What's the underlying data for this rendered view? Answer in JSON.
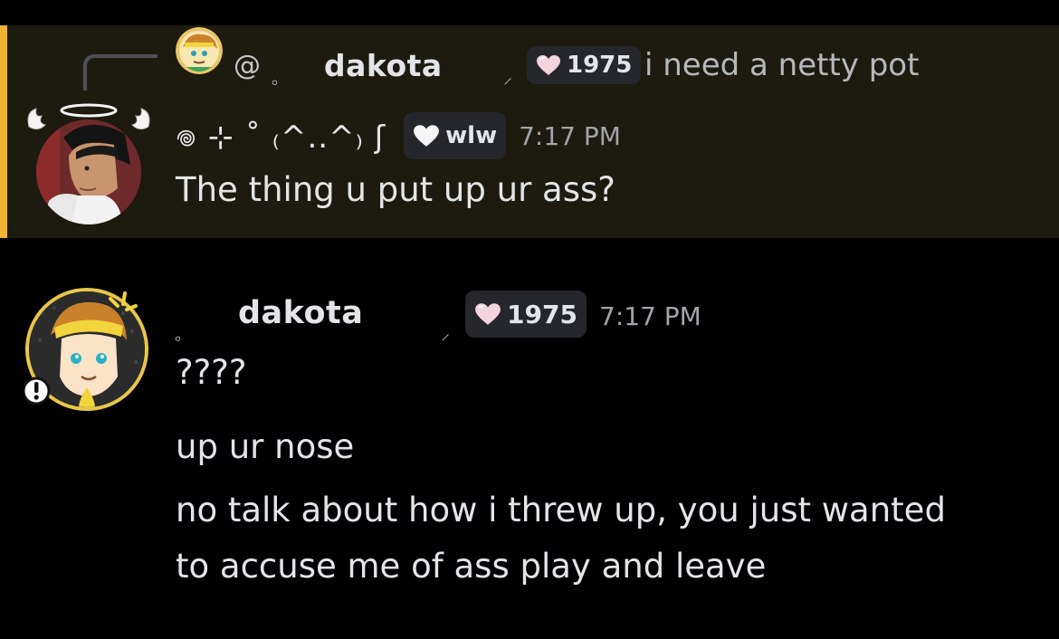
{
  "reply_preview": {
    "mention": "@",
    "ring": "。",
    "author": "dakota",
    "slash": "⸝",
    "tag_label": "1975",
    "text": "i need a netty pot"
  },
  "message1": {
    "author": "𖦹 ⊹ ˚ ₍^..^₎ ʃ",
    "tag_label": "wlw",
    "timestamp": "7:17 PM",
    "text": "The thing u put up ur ass?"
  },
  "message2": {
    "ring": "。",
    "author": "dakota",
    "slash": "⸝",
    "tag_label": "1975",
    "timestamp": "7:17 PM",
    "lines": [
      "????",
      "up ur nose",
      "no talk about how i threw up, you just wanted",
      "to accuse me of ass play and leave"
    ]
  },
  "colors": {
    "mention_highlight_bg": "#1d1a0f",
    "mention_bar": "#f0b232",
    "background": "#000000",
    "tag_bg": "#26272c",
    "heart_pink": "#f3d3dc"
  },
  "icons": {
    "reply_spine": "reply-spine",
    "tag_heart": "heart-icon",
    "halo": "halo-icon",
    "wings": "angel-wings-icon",
    "alert": "exclamation-badge-icon"
  }
}
